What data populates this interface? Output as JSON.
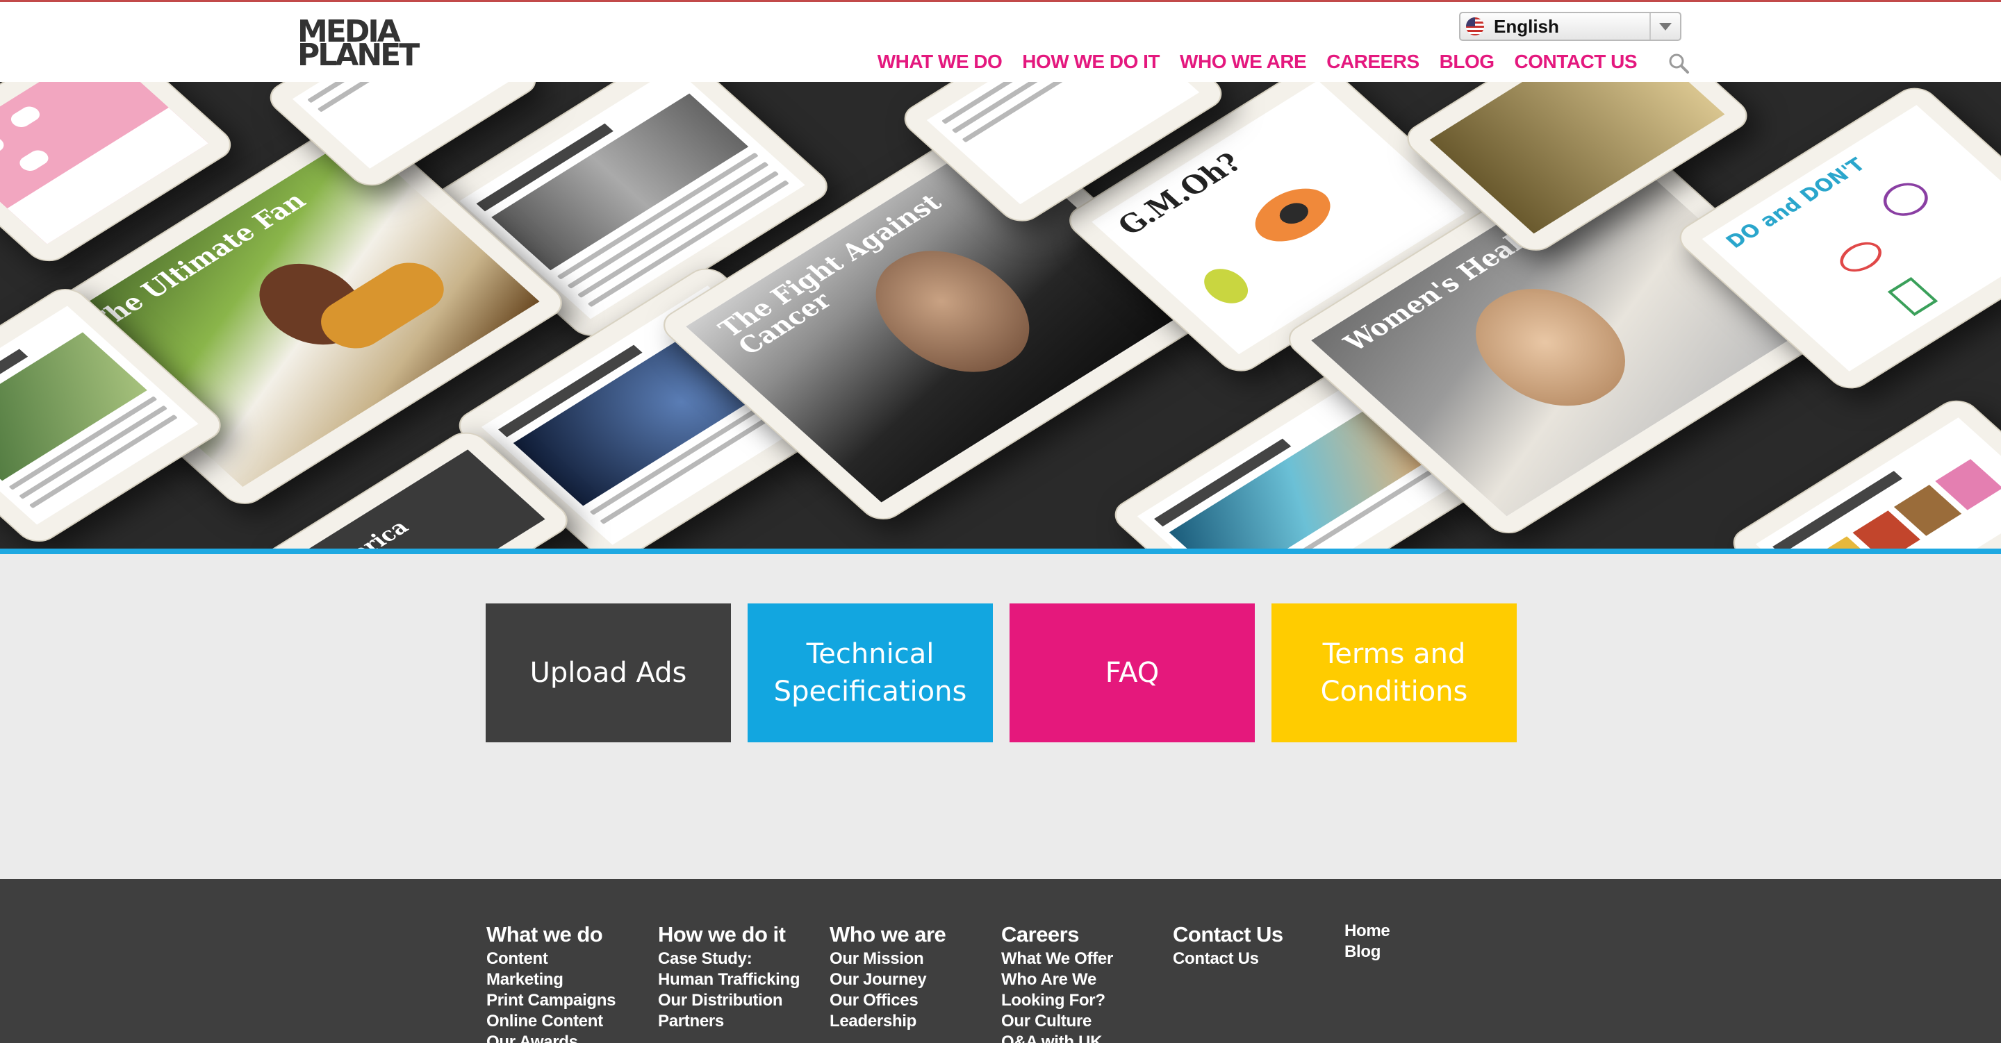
{
  "brand": {
    "logo_line1": "MEDIA",
    "logo_line2": "PLANET"
  },
  "language": {
    "selected": "English"
  },
  "nav": {
    "items": [
      {
        "label": "WHAT WE DO"
      },
      {
        "label": "HOW WE DO IT"
      },
      {
        "label": "WHO WE ARE"
      },
      {
        "label": "CAREERS"
      },
      {
        "label": "BLOG"
      },
      {
        "label": "CONTACT US"
      }
    ]
  },
  "hero": {
    "covers": {
      "ultimate_fan": "The Ultimate Fan",
      "fight_cancer": "The Fight Against Cancer",
      "womens_health": "Women's Health",
      "gmoh": "G.M.Oh?",
      "dos_donts": "DO and DON'T",
      "america": "America"
    }
  },
  "tiles": {
    "upload": "Upload Ads",
    "tech": "Technical Specifications",
    "faq": "FAQ",
    "terms": "Terms and Conditions"
  },
  "footer": {
    "columns": [
      {
        "heading": "What we do",
        "items": [
          "Content",
          "Marketing",
          "Print Campaigns",
          "Online Content",
          "Our Awards"
        ]
      },
      {
        "heading": "How we do it",
        "items": [
          "Case Study:",
          "Human Trafficking",
          "Our Distribution",
          "Partners"
        ]
      },
      {
        "heading": "Who we are",
        "items": [
          "Our Mission",
          "Our Journey",
          "Our Offices",
          "Leadership"
        ]
      },
      {
        "heading": "Careers",
        "items": [
          "What We Offer",
          "Who Are We",
          "Looking For?",
          "Our Culture",
          "Q&A with UK"
        ]
      },
      {
        "heading": "Contact Us",
        "items": [
          "Contact Us"
        ]
      },
      {
        "heading": "",
        "items": [
          "Home",
          "Blog"
        ]
      }
    ]
  },
  "colors": {
    "nav_pink": "#e4187e",
    "hero_bar_blue": "#1fa8e1",
    "tile_upload": "#3f3f3f",
    "tile_tech": "#12a6e0",
    "tile_faq": "#e5187c",
    "tile_terms": "#ffcc00",
    "footer_bg": "#3f3f3f"
  }
}
